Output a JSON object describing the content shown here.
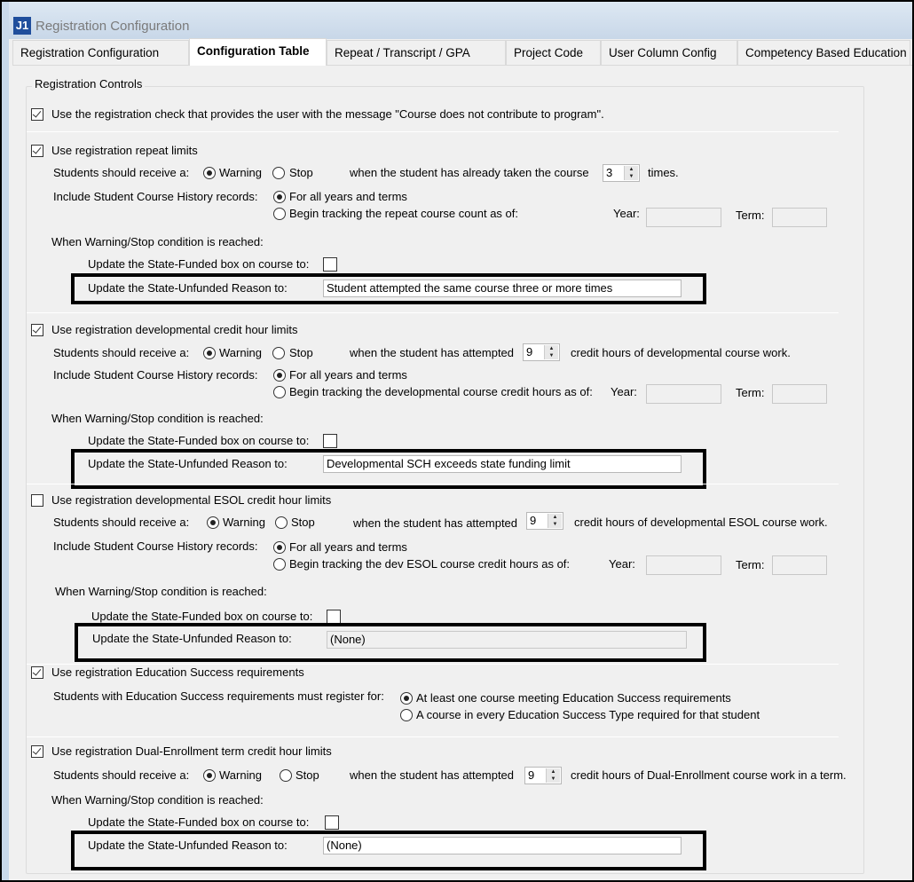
{
  "window": {
    "title": "Registration Configuration",
    "icon_text": "J1"
  },
  "tabs": [
    "Registration Configuration",
    "Configuration Table",
    "Repeat / Transcript / GPA",
    "Project Code",
    "User Column Config",
    "Competency Based Education"
  ],
  "group_label": "Registration Controls",
  "course_check": {
    "checked": true,
    "label": "Use the registration check that provides the user with the message \"Course does not contribute to program\"."
  },
  "common": {
    "receive": "Students should receive a:",
    "warning": "Warning",
    "stop": "Stop",
    "include": "Include Student Course History records:",
    "all_years": "For all years and terms",
    "year": "Year:",
    "term": "Term:",
    "when": "When Warning/Stop condition is reached:",
    "funded": "Update the State-Funded box on course to:",
    "unfunded": "Update the State-Unfunded Reason to:"
  },
  "repeat": {
    "checked": true,
    "label": "Use registration repeat limits",
    "when_text": "when the student has already taken the course",
    "count": "3",
    "after": "times.",
    "begin": "Begin tracking the repeat course count as of:",
    "year": "",
    "term": "",
    "reason": "Student attempted the same course three or more times"
  },
  "dev": {
    "checked": true,
    "label": "Use registration developmental credit hour limits",
    "when_text": "when the student has attempted",
    "count": "9",
    "after": "credit hours of developmental course work.",
    "begin": "Begin tracking the developmental course credit hours as of:",
    "year": "",
    "term": "",
    "reason": "Developmental SCH exceeds state funding limit"
  },
  "esol": {
    "checked": false,
    "label": "Use registration developmental ESOL credit hour limits",
    "when_text": "when the student has attempted",
    "count": "9",
    "after": "credit hours of developmental ESOL course work.",
    "begin": "Begin tracking the dev ESOL course credit hours as of:",
    "year": "",
    "term": "",
    "reason": "(None)"
  },
  "edsuccess": {
    "checked": true,
    "label": "Use registration Education Success requirements",
    "prompt": "Students with Education Success requirements must register for:",
    "opt1": "At least one course meeting Education Success requirements",
    "opt2": "A course in every Education Success Type required for that student"
  },
  "dual": {
    "checked": true,
    "label": "Use registration Dual-Enrollment term credit hour limits",
    "when_text": "when the student has attempted",
    "count": "9",
    "after": "credit hours of Dual-Enrollment course work in a term.",
    "reason": "(None)"
  }
}
